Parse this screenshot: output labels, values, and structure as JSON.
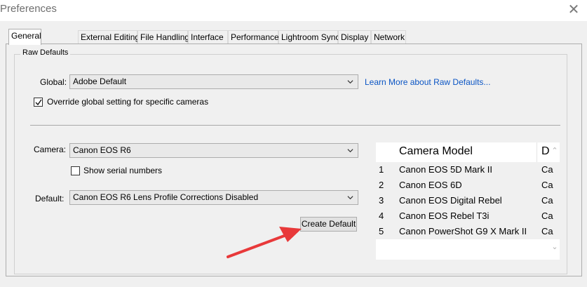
{
  "window": {
    "title": "Preferences"
  },
  "tabs": [
    {
      "label": "General",
      "active": true
    },
    {
      "label": "External Editing",
      "active": false
    },
    {
      "label": "File Handling",
      "active": false
    },
    {
      "label": "Interface",
      "active": false
    },
    {
      "label": "Performance",
      "active": false
    },
    {
      "label": "Lightroom Sync",
      "active": false
    },
    {
      "label": "Display",
      "active": false
    },
    {
      "label": "Network",
      "active": false
    }
  ],
  "raw_defaults": {
    "group_label": "Raw Defaults",
    "global_label": "Global:",
    "global_value": "Adobe Default",
    "learn_more": "Learn More about Raw Defaults...",
    "override_label": "Override global setting for specific cameras",
    "override_checked": true,
    "camera_label": "Camera:",
    "camera_value": "Canon EOS R6",
    "serial_label": "Show serial numbers",
    "serial_checked": false,
    "default_label": "Default:",
    "default_value": "Canon EOS R6 Lens Profile Corrections Disabled",
    "create_button": "Create Default"
  },
  "camera_table": {
    "col_model": "Camera Model",
    "col_d": "D",
    "rows": [
      {
        "num": "1",
        "model": "Canon EOS 5D Mark II",
        "d": "Ca"
      },
      {
        "num": "2",
        "model": "Canon EOS 6D",
        "d": "Ca"
      },
      {
        "num": "3",
        "model": "Canon EOS Digital Rebel",
        "d": "Ca"
      },
      {
        "num": "4",
        "model": "Canon EOS Rebel T3i",
        "d": "Ca"
      },
      {
        "num": "5",
        "model": "Canon PowerShot G9 X Mark II",
        "d": "Ca"
      }
    ]
  },
  "colors": {
    "link": "#0b55c4",
    "annotation_arrow": "#e8393a"
  },
  "icons": {
    "close": "close-icon",
    "dropdown": "chevron-down-icon",
    "check": "check-icon",
    "scroll_up": "chevron-up-icon",
    "scroll_down": "chevron-down-icon"
  }
}
